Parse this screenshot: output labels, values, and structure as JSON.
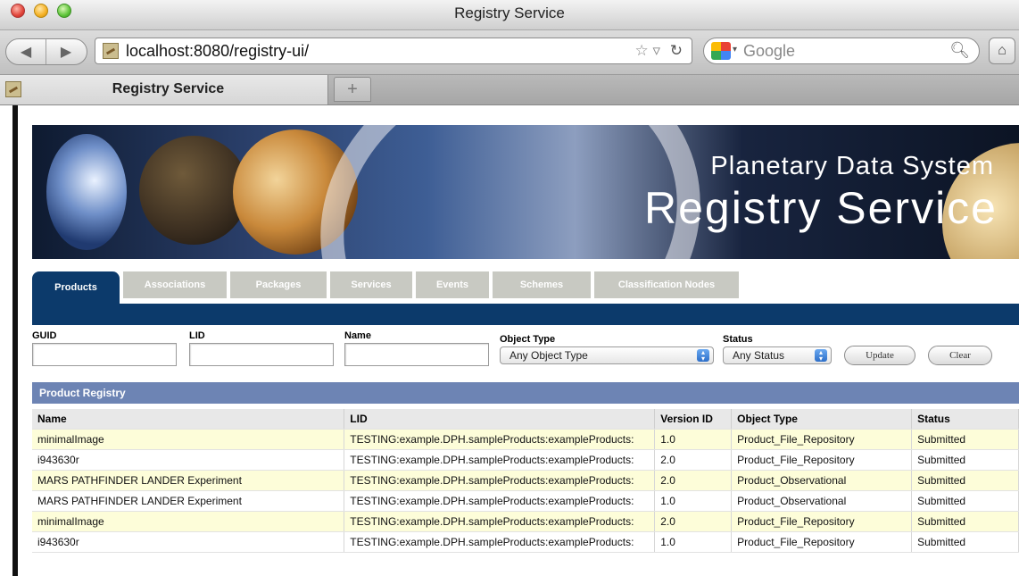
{
  "window": {
    "title": "Registry Service"
  },
  "toolbar": {
    "url": "localhost:8080/registry-ui/",
    "search_placeholder": "Google"
  },
  "tabs": [
    {
      "label": "Registry Service"
    }
  ],
  "banner": {
    "subtitle": "Planetary Data System",
    "title": "Registry Service"
  },
  "nav_tabs": [
    {
      "label": "Products",
      "active": true
    },
    {
      "label": "Associations",
      "active": false
    },
    {
      "label": "Packages",
      "active": false
    },
    {
      "label": "Services",
      "active": false
    },
    {
      "label": "Events",
      "active": false
    },
    {
      "label": "Schemes",
      "active": false
    },
    {
      "label": "Classification Nodes",
      "active": false
    }
  ],
  "filters": {
    "guid_label": "GUID",
    "lid_label": "LID",
    "name_label": "Name",
    "object_type_label": "Object Type",
    "object_type_value": "Any Object Type",
    "status_label": "Status",
    "status_value": "Any Status",
    "update_label": "Update",
    "clear_label": "Clear"
  },
  "registry": {
    "title": "Product Registry",
    "columns": [
      "Name",
      "LID",
      "Version ID",
      "Object Type",
      "Status"
    ],
    "rows": [
      [
        "minimalImage",
        "TESTING:example.DPH.sampleProducts:exampleProducts:",
        "1.0",
        "Product_File_Repository",
        "Submitted"
      ],
      [
        "i943630r",
        "TESTING:example.DPH.sampleProducts:exampleProducts:",
        "2.0",
        "Product_File_Repository",
        "Submitted"
      ],
      [
        "MARS PATHFINDER LANDER Experiment",
        "TESTING:example.DPH.sampleProducts:exampleProducts:",
        "2.0",
        "Product_Observational",
        "Submitted"
      ],
      [
        "MARS PATHFINDER LANDER Experiment",
        "TESTING:example.DPH.sampleProducts:exampleProducts:",
        "1.0",
        "Product_Observational",
        "Submitted"
      ],
      [
        "minimalImage",
        "TESTING:example.DPH.sampleProducts:exampleProducts:",
        "2.0",
        "Product_File_Repository",
        "Submitted"
      ],
      [
        "i943630r",
        "TESTING:example.DPH.sampleProducts:exampleProducts:",
        "1.0",
        "Product_File_Repository",
        "Submitted"
      ]
    ]
  },
  "colors": {
    "nav_active": "#0c3a6b",
    "nav_inactive": "#c8c9c2",
    "panel_header": "#6d84b4",
    "row_highlight": "#fdfdd9"
  }
}
